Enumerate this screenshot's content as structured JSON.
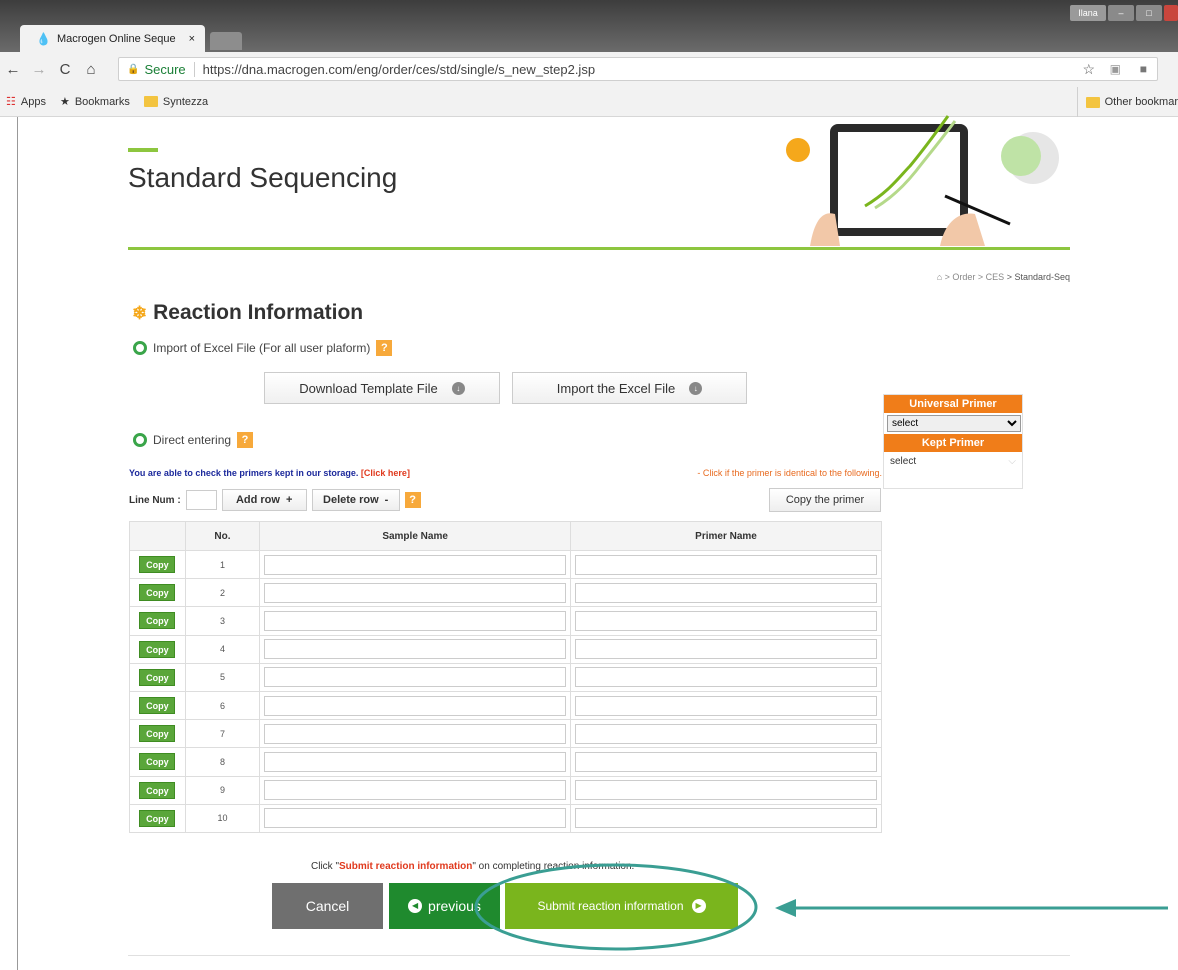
{
  "browser": {
    "tab_title": "Macrogen Online Seque",
    "tab_close": "×",
    "secure_label": "Secure",
    "url": "https://dna.macrogen.com/eng/order/ces/std/single/s_new_step2.jsp",
    "user_badge": "Ilana",
    "bookmarks": [
      "Apps",
      "Bookmarks",
      "Syntezza"
    ],
    "other_bookmarks": "Other bookmar"
  },
  "page": {
    "title": "Standard Sequencing",
    "breadcrumb": {
      "sep1": "> Order",
      "sep2": "> CES",
      "current": "> Standard-Seq"
    },
    "section_title": "Reaction Information",
    "excel_option": "Import of Excel File (For all user plaform)",
    "download_btn": "Download Template File",
    "import_btn": "Import the Excel File",
    "direct_option": "Direct entering",
    "help": "?",
    "blue_note": "You are able to check the primers kept in our storage.",
    "blue_link": "[Click here]",
    "orange_note": "- Click if the primer is identical to the following.",
    "line_num_label": "Line Num :",
    "add_row": "Add row",
    "add_sym": "+",
    "delete_row": "Delete row",
    "delete_sym": "-",
    "copy_primer": "Copy the primer"
  },
  "side_panel": {
    "universal_title": "Universal Primer",
    "universal_value": "select",
    "kept_title": "Kept Primer",
    "kept_value": "select"
  },
  "table": {
    "headers": {
      "no": "No.",
      "sample": "Sample Name",
      "primer": "Primer Name"
    },
    "copy_label": "Copy",
    "rows": [
      "1",
      "2",
      "3",
      "4",
      "5",
      "6",
      "7",
      "8",
      "9",
      "10"
    ]
  },
  "footer": {
    "instr_pre": "Click \"",
    "instr_link": "Submit reaction information",
    "instr_post": "\" on completing reaction information.",
    "cancel": "Cancel",
    "previous": "previous",
    "submit": "Submit reaction information"
  },
  "colors": {
    "accent_green": "#8dc63f",
    "orange": "#f07d19",
    "annotation": "#3a9e93"
  }
}
